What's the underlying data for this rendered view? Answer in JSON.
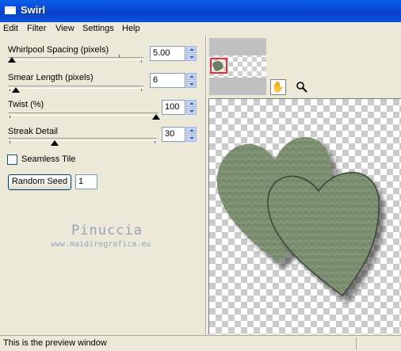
{
  "window": {
    "title": "Swirl"
  },
  "menu": [
    "Edit",
    "Filter",
    "View",
    "Settings",
    "Help"
  ],
  "controls": {
    "whirlpool": {
      "label": "Whirlpool Spacing (pixels)",
      "value": "5.00",
      "level": 0.0
    },
    "smear": {
      "label": "Smear Length (pixels)",
      "value": "6",
      "level": 0.03
    },
    "twist": {
      "label": "Twist (%)",
      "value": "100",
      "level": 1.0
    },
    "streak": {
      "label": "Streak Detail",
      "value": "30",
      "level": 0.3
    }
  },
  "seamless": {
    "label": "Seamless Tile",
    "checked": false
  },
  "random_seed": {
    "button_label": "Random Seed",
    "value": "1"
  },
  "watermark": {
    "name": "Pinuccia",
    "url": "www.maidiregrafica.eu"
  },
  "tools": {
    "pan": "hand-icon",
    "zoom": "magnifier-icon"
  },
  "status": {
    "text": "This is the preview window"
  },
  "colors": {
    "title_bar": "#0a47d6",
    "heart_fill": "#7a8d6f",
    "selection_rect": "#e63030"
  }
}
